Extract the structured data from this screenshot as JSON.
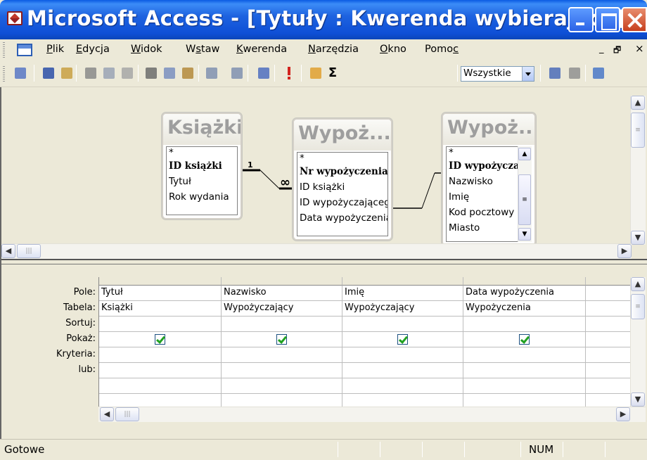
{
  "window": {
    "title": "Microsoft Access - [Tytuły : Kwerenda wybierająca]"
  },
  "menu": {
    "items": [
      {
        "label": "Plik",
        "ul": "P",
        "rest": "lik"
      },
      {
        "label": "Edycja",
        "ul": "E",
        "rest": "dycja"
      },
      {
        "label": "Widok",
        "ul": "W",
        "rest": "idok"
      },
      {
        "label": "Wstaw",
        "pre": "W",
        "ul": "s",
        "rest": "taw"
      },
      {
        "label": "Kwerenda",
        "ul": "K",
        "rest": "werenda"
      },
      {
        "label": "Narzędzia",
        "ul": "N",
        "rest": "arzędzia"
      },
      {
        "label": "Okno",
        "ul": "O",
        "rest": "kno"
      },
      {
        "label": "Pomoc",
        "pre": "Pomo",
        "ul": "c",
        "rest": ""
      }
    ],
    "mdi_minimize": "_",
    "mdi_restore": "🗗",
    "mdi_close": "×"
  },
  "toolbar": {
    "top_values_combo": "Wszystkie",
    "icons": [
      "view-icon",
      "save-icon",
      "search-icon",
      "print-icon",
      "print-preview-icon",
      "spelling-icon",
      "cut-icon",
      "copy-icon",
      "paste-icon",
      "undo-icon",
      "redo-icon",
      "query-type-icon",
      "run-icon",
      "show-table-icon",
      "totals-icon",
      "properties-icon",
      "build-icon",
      "database-window-icon"
    ]
  },
  "tables": [
    {
      "title": "Książki",
      "fields": [
        "*",
        "ID książki",
        "Tytuł",
        "Rok wydania"
      ],
      "key_field": "ID książki"
    },
    {
      "title": "Wypoż...",
      "fields": [
        "*",
        "Nr wypożyczenia",
        "ID książki",
        "ID wypożyczającego",
        "Data wypożyczenia"
      ],
      "key_field": "Nr wypożyczenia"
    },
    {
      "title": "Wypoż...",
      "fields": [
        "*",
        "ID wypożyczającego",
        "Nazwisko",
        "Imię",
        "Kod pocztowy",
        "Miasto"
      ],
      "key_field": "ID wypożyczającego"
    }
  ],
  "relationship": {
    "one_label": "1",
    "many_label": "∞"
  },
  "grid": {
    "row_labels": [
      "Pole:",
      "Tabela:",
      "Sortuj:",
      "Pokaż:",
      "Kryteria:",
      "lub:"
    ],
    "columns": [
      {
        "field": "Tytuł",
        "table": "Książki",
        "sort": "",
        "show": true,
        "criteria": "",
        "or": ""
      },
      {
        "field": "Nazwisko",
        "table": "Wypożyczający",
        "sort": "",
        "show": true,
        "criteria": "",
        "or": ""
      },
      {
        "field": "Imię",
        "table": "Wypożyczający",
        "sort": "",
        "show": true,
        "criteria": "",
        "or": ""
      },
      {
        "field": "Data wypożyczenia",
        "table": "Wypożyczenia",
        "sort": "",
        "show": true,
        "criteria": "",
        "or": ""
      }
    ]
  },
  "status": {
    "text": "Gotowe",
    "num": "NUM"
  }
}
